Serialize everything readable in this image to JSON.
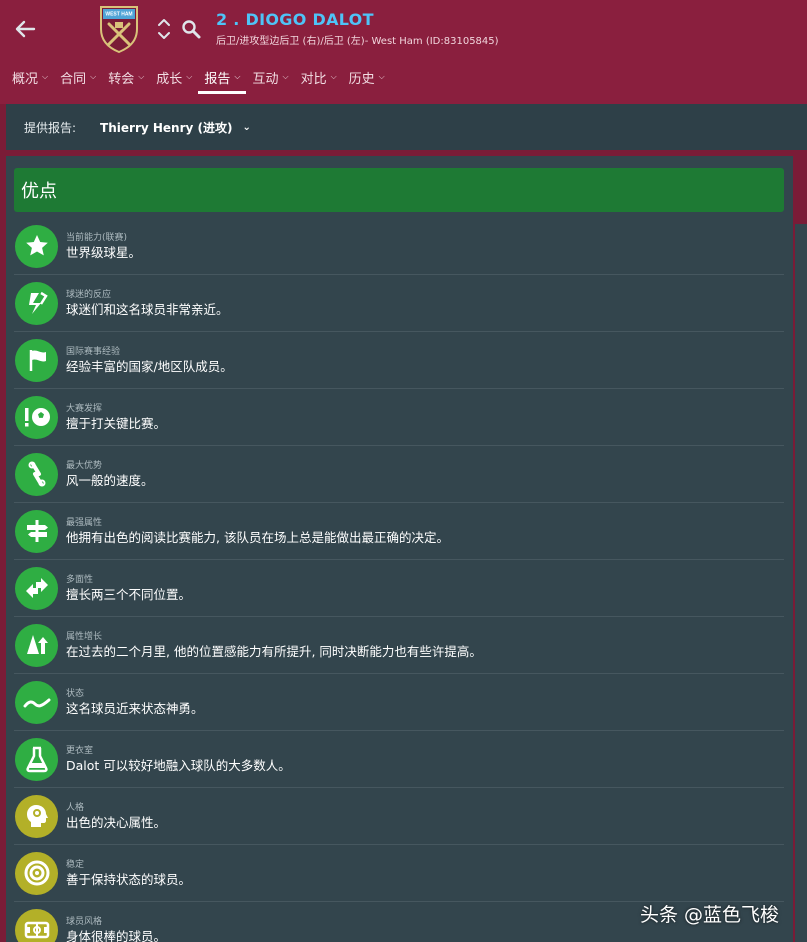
{
  "header": {
    "player_name": "2 . DIOGO DALOT",
    "player_subtitle": "后卫/进攻型边后卫 (右)/后卫 (左)- West Ham (ID:83105845)",
    "crest_text": "WEST HAM UNITED"
  },
  "nav": {
    "tabs": [
      {
        "label": "概况"
      },
      {
        "label": "合同"
      },
      {
        "label": "转会"
      },
      {
        "label": "成长"
      },
      {
        "label": "报告"
      },
      {
        "label": "互动"
      },
      {
        "label": "对比"
      },
      {
        "label": "历史"
      }
    ],
    "active": "报告"
  },
  "report_bar": {
    "label": "提供报告:",
    "selected": "Thierry Henry (进攻)"
  },
  "strengths": {
    "title": "优点",
    "items": [
      {
        "category": "当前能力(联赛)",
        "text": "世界级球星。",
        "icon": "star-icon"
      },
      {
        "category": "球迷的反应",
        "text": "球迷们和这名球员非常亲近。",
        "icon": "scarf-icon"
      },
      {
        "category": "国际赛事经验",
        "text": "经验丰富的国家/地区队成员。",
        "icon": "flag-icon"
      },
      {
        "category": "大赛发挥",
        "text": "擅于打关键比赛。",
        "icon": "big-match-ball-icon"
      },
      {
        "category": "最大优势",
        "text": "风一般的速度。",
        "icon": "chain-link-icon"
      },
      {
        "category": "最强属性",
        "text": "他拥有出色的阅读比赛能力, 该队员在场上总是能做出最正确的决定。",
        "icon": "signpost-icon"
      },
      {
        "category": "多面性",
        "text": "擅长两三个不同位置。",
        "icon": "swap-arrows-icon"
      },
      {
        "category": "属性增长",
        "text": "在过去的二个月里, 他的位置感能力有所提升, 同时决断能力也有些许提高。",
        "icon": "cone-growth-icon"
      },
      {
        "category": "状态",
        "text": "这名球员近来状态神勇。",
        "icon": "trend-line-icon"
      },
      {
        "category": "更衣室",
        "text": "Dalot 可以较好地融入球队的大多数人。",
        "icon": "flask-icon"
      },
      {
        "category": "人格",
        "text": "出色的决心属性。",
        "icon": "head-profile-icon"
      },
      {
        "category": "稳定",
        "text": "善于保持状态的球员。",
        "icon": "target-icon"
      },
      {
        "category": "球员风格",
        "text": "身体很棒的球员。",
        "icon": "pitch-icon"
      }
    ]
  },
  "colors": {
    "header_bg": "#8a1f3e",
    "panel_bg": "#33454d",
    "strength_green": "#1e7a34",
    "icon_green": "#2fae43",
    "icon_olive": "#b3b028",
    "name_blue": "#4fc3f7"
  },
  "watermark": "头条 @蓝色飞梭"
}
